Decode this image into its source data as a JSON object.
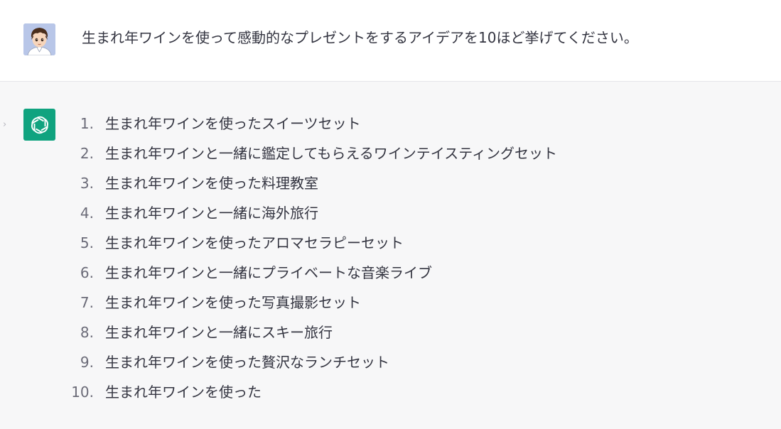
{
  "user_message": {
    "avatar_icon": "user-avatar-boy-icon",
    "text": "生まれ年ワインを使って感動的なプレゼントをするアイデアを10ほど挙げてください。"
  },
  "assistant_message": {
    "logo_icon": "openai-logo-icon",
    "side_icon": "chevron-right-icon",
    "accent_color": "#10a37f",
    "items": [
      {
        "num": "1.",
        "text": "生まれ年ワインを使ったスイーツセット"
      },
      {
        "num": "2.",
        "text": "生まれ年ワインと一緒に鑑定してもらえるワインテイスティングセット"
      },
      {
        "num": "3.",
        "text": "生まれ年ワインを使った料理教室"
      },
      {
        "num": "4.",
        "text": "生まれ年ワインと一緒に海外旅行"
      },
      {
        "num": "5.",
        "text": "生まれ年ワインを使ったアロマセラピーセット"
      },
      {
        "num": "6.",
        "text": "生まれ年ワインと一緒にプライベートな音楽ライブ"
      },
      {
        "num": "7.",
        "text": "生まれ年ワインを使った写真撮影セット"
      },
      {
        "num": "8.",
        "text": "生まれ年ワインと一緒にスキー旅行"
      },
      {
        "num": "9.",
        "text": "生まれ年ワインを使った贅沢なランチセット"
      },
      {
        "num": "10.",
        "text": "生まれ年ワインを使った"
      }
    ]
  }
}
